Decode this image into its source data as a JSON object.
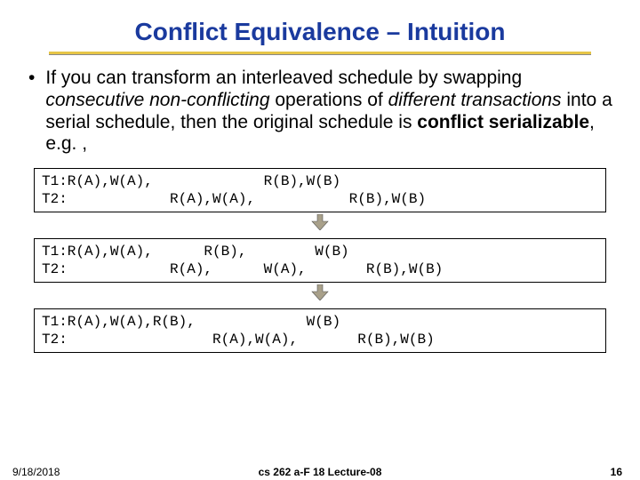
{
  "title": "Conflict Equivalence – Intuition",
  "bullet": {
    "pre": "If you can transform an interleaved schedule by swapping ",
    "em1": "consecutive non-conflicting",
    "mid1": " operations of ",
    "em2": "different transactions",
    "mid2": " into a serial schedule, then the original schedule is ",
    "bold": "conflict serializable",
    "post": ", e.g. ,"
  },
  "schedules": {
    "s1": "T1:R(A),W(A),             R(B),W(B)\nT2:            R(A),W(A),           R(B),W(B)",
    "s2": "T1:R(A),W(A),      R(B),        W(B)\nT2:            R(A),      W(A),       R(B),W(B)",
    "s3": "T1:R(A),W(A),R(B),             W(B)\nT2:                 R(A),W(A),       R(B),W(B)"
  },
  "footer": {
    "date": "9/18/2018",
    "course": "cs 262 a-F 18 Lecture-08",
    "page": "16"
  }
}
